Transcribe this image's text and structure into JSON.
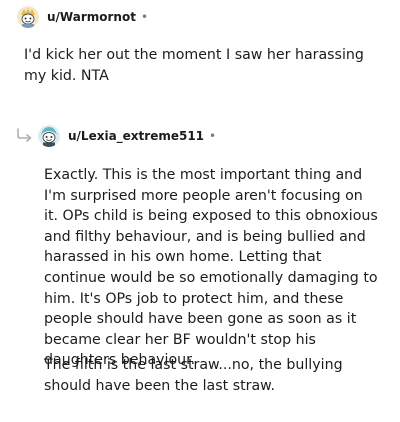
{
  "comments": [
    {
      "username": "u/Warmornot",
      "separator": "•",
      "paragraphs": [
        "I'd kick her out the moment I saw her harassing my kid. NTA"
      ]
    },
    {
      "username": "u/Lexia_extreme511",
      "separator": "•",
      "paragraphs": [
        "Exactly. This is the most important thing and I'm surprised more people aren't focusing on it. OPs child is being exposed to this obnoxious and filthy behaviour, and is being bullied and harassed in his own home. Letting that continue would be so emotionally damaging to him. It's OPs job to protect him, and these people should have been gone as soon as it became clear her BF wouldn't stop his daughters behaviour.",
        "The filth is the last straw...no, the bullying should have been the last straw."
      ]
    }
  ],
  "icons": {
    "avatar_1": "snoo-avatar-icon",
    "avatar_2": "snoo-avatar-icon",
    "reply_indicator": "reply-arrow-icon"
  },
  "colors": {
    "text": "#1c1c1c",
    "muted": "#7c7c7c",
    "avatar_1_bg": "#f2e7c9",
    "avatar_2_bg": "#d8eef0"
  }
}
